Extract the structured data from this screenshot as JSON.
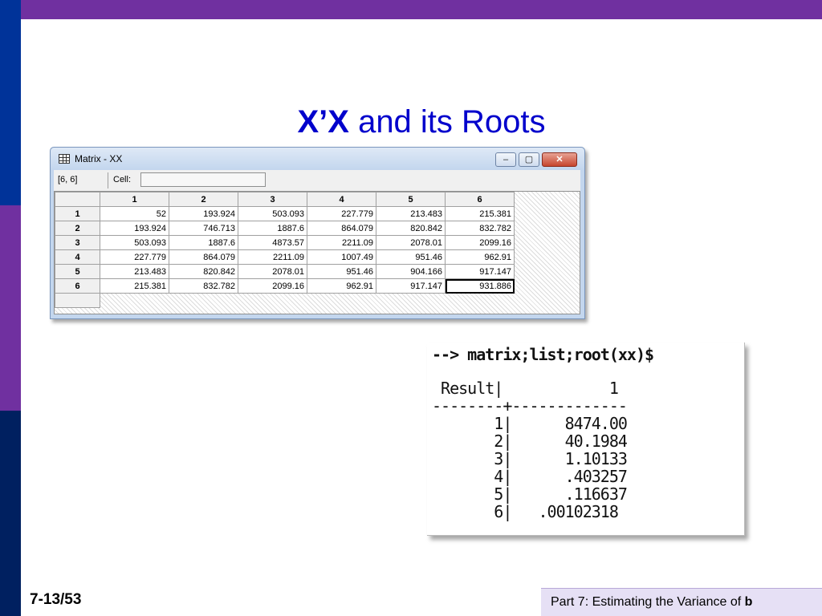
{
  "slide": {
    "title_bold": "X’X",
    "title_rest": " and its Roots",
    "page_number": "7-13/53",
    "footer_text": "Part 7: Estimating the Variance of ",
    "footer_bold": "b"
  },
  "window": {
    "title": "Matrix - XX",
    "minimize_label": "–",
    "maximize_label": "▢",
    "close_label": "✕"
  },
  "infobar": {
    "dims": "[6, 6]",
    "cell_label": "Cell:",
    "cell_value": ""
  },
  "matrix": {
    "columns": [
      "1",
      "2",
      "3",
      "4",
      "5",
      "6"
    ],
    "rows": [
      {
        "label": "1",
        "values": [
          "52",
          "193.924",
          "503.093",
          "227.779",
          "213.483",
          "215.381"
        ]
      },
      {
        "label": "2",
        "values": [
          "193.924",
          "746.713",
          "1887.6",
          "864.079",
          "820.842",
          "832.782"
        ]
      },
      {
        "label": "3",
        "values": [
          "503.093",
          "1887.6",
          "4873.57",
          "2211.09",
          "2078.01",
          "2099.16"
        ]
      },
      {
        "label": "4",
        "values": [
          "227.779",
          "864.079",
          "2211.09",
          "1007.49",
          "951.46",
          "962.91"
        ]
      },
      {
        "label": "5",
        "values": [
          "213.483",
          "820.842",
          "2078.01",
          "951.46",
          "904.166",
          "917.147"
        ]
      },
      {
        "label": "6",
        "values": [
          "215.381",
          "832.782",
          "2099.16",
          "962.91",
          "917.147",
          "931.886"
        ]
      }
    ]
  },
  "console": {
    "command": "--> matrix;list;root(xx)$",
    "lines": [
      " Result|            1",
      "--------+-------------",
      "       1|      8474.00",
      "       2|      40.1984",
      "       3|      1.10133",
      "       4|      .403257",
      "       5|      .116637",
      "       6|   .00102318"
    ]
  }
}
